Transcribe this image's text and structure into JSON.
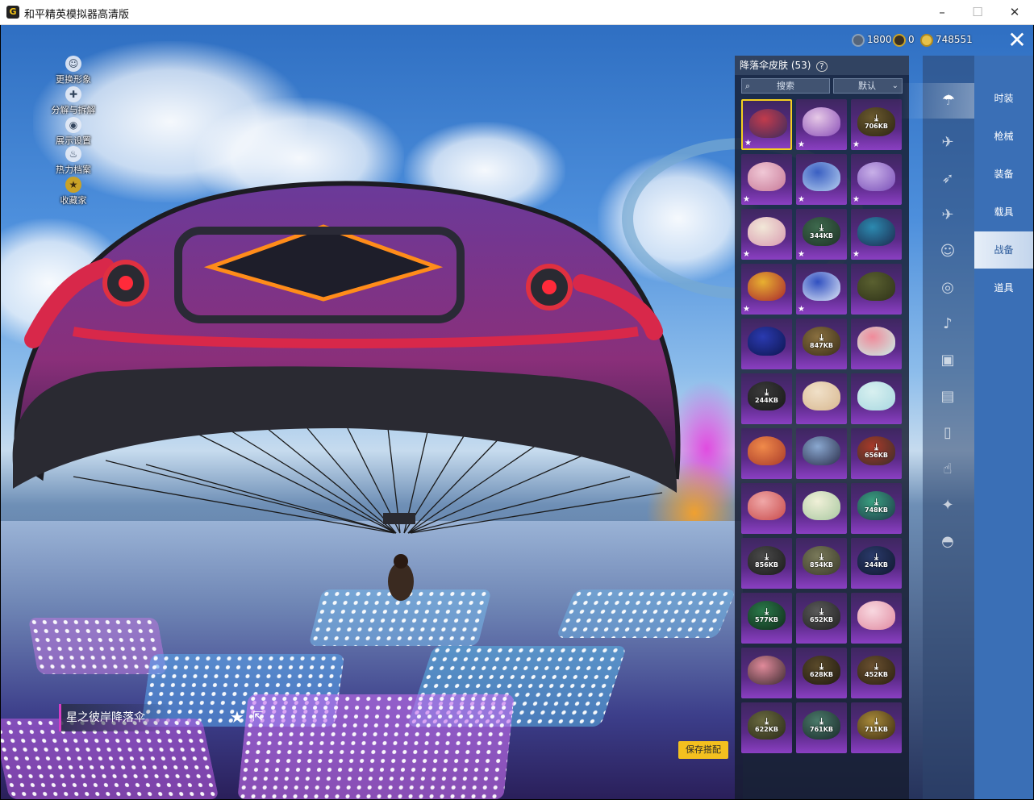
{
  "window": {
    "title": "和平精英模拟器高清版",
    "minimize_glyph": "–",
    "maximize_glyph": "☐",
    "close_glyph": "✕"
  },
  "side_menu": [
    {
      "label": "更换形象",
      "icon": "avatar-icon"
    },
    {
      "label": "分解与拆解",
      "icon": "decompose-icon"
    },
    {
      "label": "展示设置",
      "icon": "eye-icon"
    },
    {
      "label": "热力档案",
      "icon": "flame-icon"
    },
    {
      "label": "收藏家",
      "icon": "collector-badge-icon"
    }
  ],
  "currency": [
    {
      "icon": "coupon-icon",
      "value": "1800",
      "color": "#8aa0b8"
    },
    {
      "icon": "uc-icon",
      "value": "0",
      "color": "#c9a227"
    },
    {
      "icon": "bp-coin-icon",
      "value": "748551",
      "color": "#e6c14a"
    }
  ],
  "panel": {
    "title": "降落伞皮肤 (53)",
    "help_glyph": "?",
    "search_placeholder": "搜索",
    "sort_label": "默认"
  },
  "skins": [
    {
      "dl": "",
      "star": true,
      "sel": true,
      "c1": "#c23b4c",
      "c2": "#3a2c5e"
    },
    {
      "dl": "",
      "star": true,
      "c1": "#e6c9e6",
      "c2": "#8a4fb8"
    },
    {
      "dl": "706KB",
      "star": true,
      "c1": "#6b5a2e",
      "c2": "#2c2413"
    },
    {
      "dl": "",
      "star": true,
      "c1": "#f0c8d6",
      "c2": "#c87a98"
    },
    {
      "dl": "",
      "star": true,
      "c1": "#3a5fc2",
      "c2": "#b6d0f0"
    },
    {
      "dl": "",
      "star": true,
      "c1": "#c8b0e8",
      "c2": "#7a4fb8"
    },
    {
      "dl": "",
      "star": true,
      "c1": "#f2e8d8",
      "c2": "#d89ab0"
    },
    {
      "dl": "344KB",
      "star": true,
      "c1": "#3e6a4e",
      "c2": "#1e3226"
    },
    {
      "dl": "",
      "star": true,
      "c1": "#2c8ab0",
      "c2": "#1c2a4e"
    },
    {
      "dl": "",
      "star": true,
      "c1": "#e8b030",
      "c2": "#a8282e"
    },
    {
      "dl": "",
      "star": true,
      "c1": "#3050c0",
      "c2": "#e0e8f8"
    },
    {
      "dl": "",
      "star": false,
      "c1": "#5a6030",
      "c2": "#2e3218"
    },
    {
      "dl": "",
      "star": false,
      "c1": "#2a3ab0",
      "c2": "#0e1650"
    },
    {
      "dl": "847KB",
      "star": false,
      "c1": "#8a7040",
      "c2": "#3a2e18"
    },
    {
      "dl": "",
      "star": false,
      "c1": "#f08a9a",
      "c2": "#c8f0e8"
    },
    {
      "dl": "244KB",
      "star": false,
      "c1": "#3a3a3a",
      "c2": "#181818"
    },
    {
      "dl": "",
      "star": false,
      "c1": "#f0e0c8",
      "c2": "#d8b890"
    },
    {
      "dl": "",
      "star": false,
      "c1": "#d8f0f0",
      "c2": "#a8d8e0"
    },
    {
      "dl": "",
      "star": false,
      "c1": "#f08a4a",
      "c2": "#a83a2a"
    },
    {
      "dl": "",
      "star": false,
      "c1": "#8aa8d0",
      "c2": "#2a2e4a"
    },
    {
      "dl": "656KB",
      "star": false,
      "c1": "#a83a2a",
      "c2": "#3a2e2a"
    },
    {
      "dl": "",
      "star": false,
      "c1": "#f0a8a8",
      "c2": "#c84a4a"
    },
    {
      "dl": "",
      "star": false,
      "c1": "#f0f0d8",
      "c2": "#a8c8a0"
    },
    {
      "dl": "748KB",
      "star": false,
      "c1": "#3aa080",
      "c2": "#1e3a48"
    },
    {
      "dl": "856KB",
      "star": false,
      "c1": "#4a4a4a",
      "c2": "#1a1a1a"
    },
    {
      "dl": "854KB",
      "star": false,
      "c1": "#7a7a5a",
      "c2": "#3a3a2a"
    },
    {
      "dl": "244KB",
      "star": false,
      "c1": "#2a3a6a",
      "c2": "#101830"
    },
    {
      "dl": "577KB",
      "star": false,
      "c1": "#2a7a4a",
      "c2": "#102a1a"
    },
    {
      "dl": "652KB",
      "star": false,
      "c1": "#5a5a5a",
      "c2": "#202020"
    },
    {
      "dl": "",
      "star": false,
      "c1": "#f8d8e0",
      "c2": "#e08aa0"
    },
    {
      "dl": "",
      "star": false,
      "c1": "#e08a9a",
      "c2": "#3a2a30"
    },
    {
      "dl": "628KB",
      "star": false,
      "c1": "#5a4a2a",
      "c2": "#201a10"
    },
    {
      "dl": "452KB",
      "star": false,
      "c1": "#6a5030",
      "c2": "#2a2010"
    },
    {
      "dl": "622KB",
      "star": false,
      "c1": "#6a6a40",
      "c2": "#2a2a18"
    },
    {
      "dl": "761KB",
      "star": false,
      "c1": "#4a7a6a",
      "c2": "#1a2a2a"
    },
    {
      "dl": "711KB",
      "star": false,
      "c1": "#a88a3a",
      "c2": "#3a2a10"
    }
  ],
  "category_icons": [
    "parachute-icon",
    "glider-icon",
    "plane-trail-icon",
    "airplane-icon",
    "emote-icon",
    "avatar-frame-icon",
    "voice-icon",
    "console-icon",
    "photo-icon",
    "spray-icon",
    "hand-gesture-icon",
    "wand-icon",
    "hat-icon"
  ],
  "tabs": [
    "时装",
    "枪械",
    "装备",
    "载具",
    "战备",
    "道具"
  ],
  "active_tab": "战备",
  "item": {
    "name": "星之彼岸降落伞",
    "save_label": "保存搭配"
  }
}
